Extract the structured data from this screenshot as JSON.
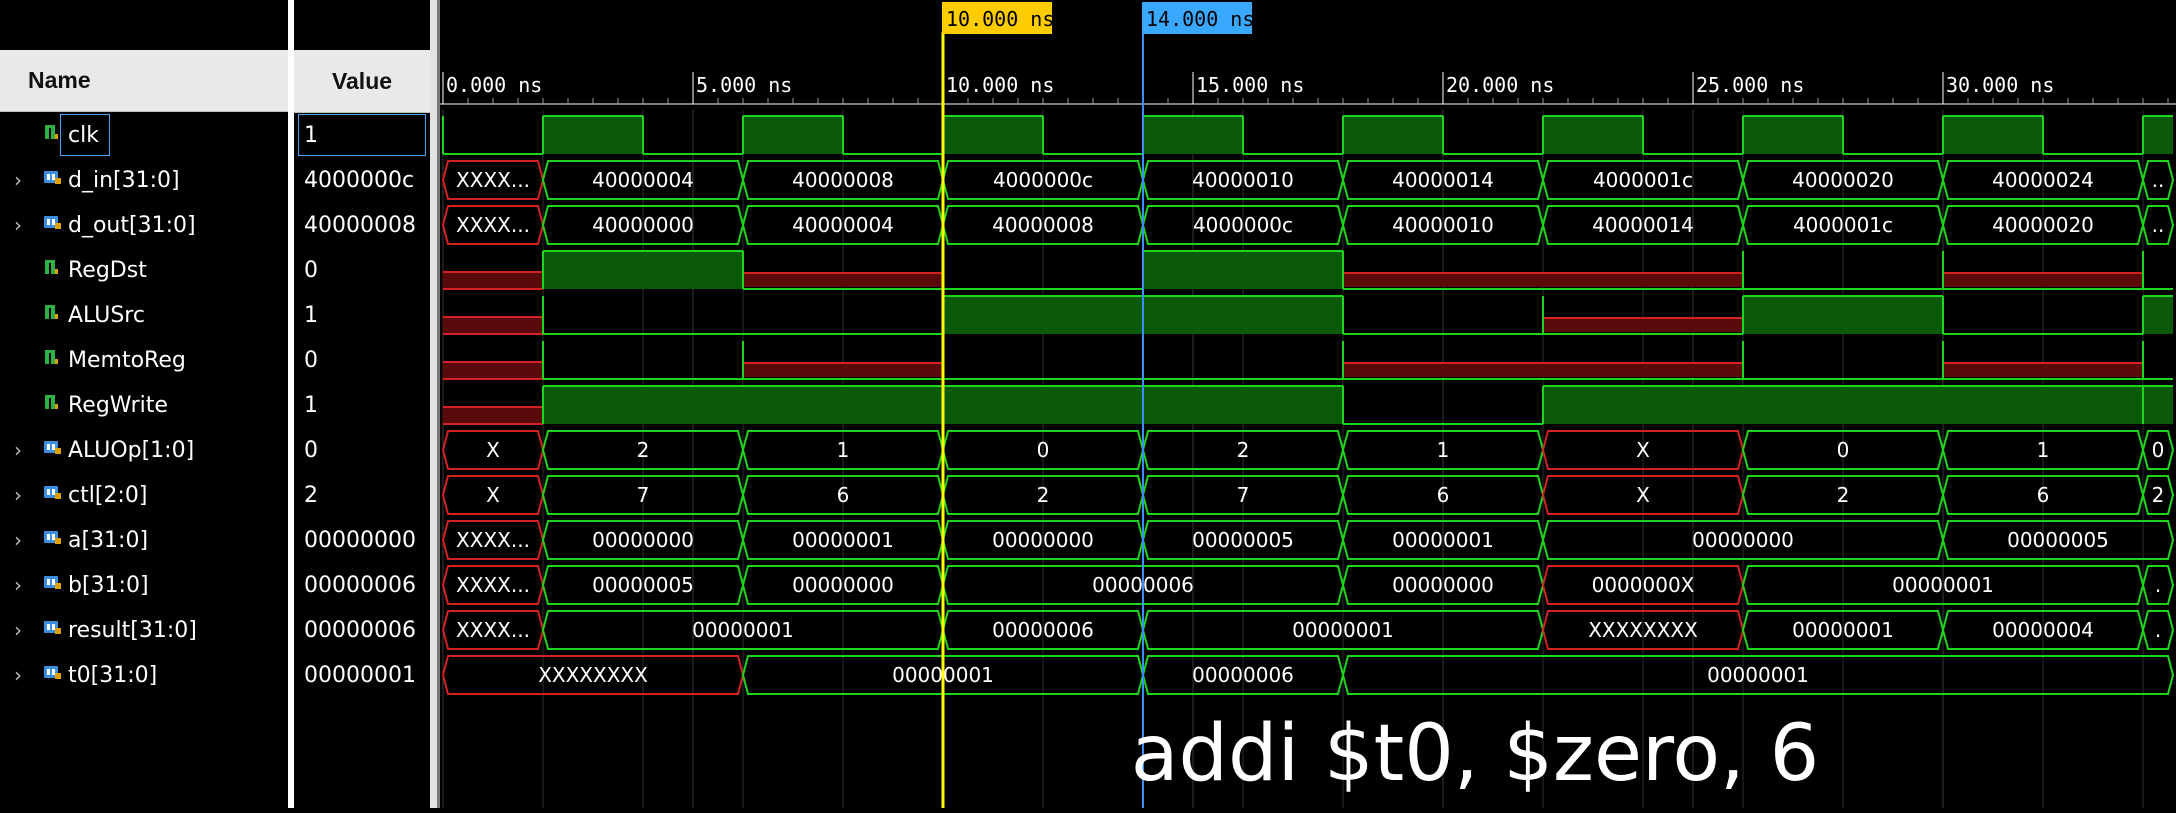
{
  "columns": {
    "name": "Name",
    "value": "Value"
  },
  "signals": [
    {
      "name": "clk",
      "value": "1",
      "icon": "bit-signal-icon",
      "expandable": false
    },
    {
      "name": "d_in[31:0]",
      "value": "4000000c",
      "icon": "bus-signal-icon",
      "expandable": true
    },
    {
      "name": "d_out[31:0]",
      "value": "40000008",
      "icon": "bus-signal-icon",
      "expandable": true
    },
    {
      "name": "RegDst",
      "value": "0",
      "icon": "bit-signal-icon",
      "expandable": false
    },
    {
      "name": "ALUSrc",
      "value": "1",
      "icon": "bit-signal-icon",
      "expandable": false
    },
    {
      "name": "MemtoReg",
      "value": "0",
      "icon": "bit-signal-icon",
      "expandable": false
    },
    {
      "name": "RegWrite",
      "value": "1",
      "icon": "bit-signal-icon",
      "expandable": false
    },
    {
      "name": "ALUOp[1:0]",
      "value": "0",
      "icon": "bus-signal-icon",
      "expandable": true
    },
    {
      "name": "ctl[2:0]",
      "value": "2",
      "icon": "bus-signal-icon",
      "expandable": true
    },
    {
      "name": "a[31:0]",
      "value": "00000000",
      "icon": "bus-signal-icon",
      "expandable": true
    },
    {
      "name": "b[31:0]",
      "value": "00000006",
      "icon": "bus-signal-icon",
      "expandable": true
    },
    {
      "name": "result[31:0]",
      "value": "00000006",
      "icon": "bus-signal-icon",
      "expandable": true
    },
    {
      "name": "t0[31:0]",
      "value": "00000001",
      "icon": "bus-signal-icon",
      "expandable": true
    }
  ],
  "timeline": {
    "ticks": [
      "0.000 ns",
      "5.000 ns",
      "10.000 ns",
      "15.000 ns",
      "20.000 ns",
      "25.000 ns",
      "30.000 ns"
    ],
    "ns_per_major": 5,
    "ns_per_minor": 0.5,
    "visible_ns": 34.6
  },
  "markers": [
    {
      "label": "10.000 ns",
      "time_ns": 10,
      "color": "#ffff00",
      "badge": "#ffcc00"
    },
    {
      "label": "14.000 ns",
      "time_ns": 14,
      "color": "#3a8fff",
      "badge": "#39a8ff"
    }
  ],
  "colors": {
    "high": "#1ed51e",
    "high_fill": "#0a5a0a",
    "unknown": "#d42222",
    "unknown_fill": "#5a0a0a",
    "bus": "#1ed51e",
    "text": "#ffffff"
  },
  "annotation": "addi $t0, $zero, 6",
  "waves": {
    "clk": {
      "type": "bit",
      "segs": [
        [
          0,
          2,
          "0"
        ],
        [
          2,
          4,
          "1"
        ],
        [
          4,
          6,
          "0"
        ],
        [
          6,
          8,
          "1"
        ],
        [
          8,
          10,
          "0"
        ],
        [
          10,
          12,
          "1"
        ],
        [
          12,
          14,
          "0"
        ],
        [
          14,
          16,
          "1"
        ],
        [
          16,
          18,
          "0"
        ],
        [
          18,
          20,
          "1"
        ],
        [
          20,
          22,
          "0"
        ],
        [
          22,
          24,
          "1"
        ],
        [
          24,
          26,
          "0"
        ],
        [
          26,
          28,
          "1"
        ],
        [
          28,
          30,
          "0"
        ],
        [
          30,
          32,
          "1"
        ],
        [
          32,
          34,
          "0"
        ],
        [
          34,
          34.6,
          "1"
        ]
      ]
    },
    "d_in": {
      "type": "bus",
      "segs": [
        [
          0,
          2,
          "XXXX...",
          "x"
        ],
        [
          2,
          6,
          "40000004"
        ],
        [
          6,
          10,
          "40000008"
        ],
        [
          10,
          14,
          "4000000c"
        ],
        [
          14,
          18,
          "40000010"
        ],
        [
          18,
          22,
          "40000014"
        ],
        [
          22,
          26,
          "4000001c"
        ],
        [
          26,
          30,
          "40000020"
        ],
        [
          30,
          34,
          "40000024"
        ],
        [
          34,
          34.6,
          ".."
        ]
      ]
    },
    "d_out": {
      "type": "bus",
      "segs": [
        [
          0,
          2,
          "XXXX...",
          "x"
        ],
        [
          2,
          6,
          "40000000"
        ],
        [
          6,
          10,
          "40000004"
        ],
        [
          10,
          14,
          "40000008"
        ],
        [
          14,
          18,
          "4000000c"
        ],
        [
          18,
          22,
          "40000010"
        ],
        [
          22,
          26,
          "40000014"
        ],
        [
          26,
          30,
          "4000001c"
        ],
        [
          30,
          34,
          "40000020"
        ],
        [
          34,
          34.6,
          ".."
        ]
      ]
    },
    "RegDst": {
      "type": "bit",
      "segs": [
        [
          0,
          2,
          "x"
        ],
        [
          2,
          6,
          "1"
        ],
        [
          6,
          10,
          "0x"
        ],
        [
          10,
          14,
          "0"
        ],
        [
          14,
          18,
          "1"
        ],
        [
          18,
          26,
          "0x"
        ],
        [
          26,
          30,
          "0"
        ],
        [
          30,
          34,
          "0x"
        ],
        [
          34,
          34.6,
          "0"
        ]
      ]
    },
    "ALUSrc": {
      "type": "bit",
      "segs": [
        [
          0,
          2,
          "x"
        ],
        [
          2,
          10,
          "0"
        ],
        [
          10,
          18,
          "1"
        ],
        [
          18,
          22,
          "0"
        ],
        [
          22,
          26,
          "0x"
        ],
        [
          26,
          30,
          "1"
        ],
        [
          30,
          34,
          "0"
        ],
        [
          34,
          34.6,
          "1"
        ]
      ]
    },
    "MemtoReg": {
      "type": "bit",
      "segs": [
        [
          0,
          2,
          "x"
        ],
        [
          2,
          6,
          "0"
        ],
        [
          6,
          10,
          "0x"
        ],
        [
          10,
          18,
          "0"
        ],
        [
          18,
          26,
          "0x"
        ],
        [
          26,
          30,
          "0"
        ],
        [
          30,
          34,
          "0x"
        ],
        [
          34,
          34.6,
          "0"
        ]
      ]
    },
    "RegWrite": {
      "type": "bit",
      "segs": [
        [
          0,
          2,
          "x"
        ],
        [
          2,
          18,
          "1"
        ],
        [
          18,
          22,
          "0"
        ],
        [
          22,
          34,
          "1"
        ],
        [
          34,
          34.6,
          "1"
        ]
      ]
    },
    "ALUOp": {
      "type": "bus",
      "segs": [
        [
          0,
          2,
          "X",
          "x"
        ],
        [
          2,
          6,
          "2"
        ],
        [
          6,
          10,
          "1"
        ],
        [
          10,
          14,
          "0"
        ],
        [
          14,
          18,
          "2"
        ],
        [
          18,
          22,
          "1"
        ],
        [
          22,
          26,
          "X",
          "x"
        ],
        [
          26,
          30,
          "0"
        ],
        [
          30,
          34,
          "1"
        ],
        [
          34,
          34.6,
          "0"
        ]
      ]
    },
    "ctl": {
      "type": "bus",
      "segs": [
        [
          0,
          2,
          "X",
          "x"
        ],
        [
          2,
          6,
          "7"
        ],
        [
          6,
          10,
          "6"
        ],
        [
          10,
          14,
          "2"
        ],
        [
          14,
          18,
          "7"
        ],
        [
          18,
          22,
          "6"
        ],
        [
          22,
          26,
          "X",
          "x"
        ],
        [
          26,
          30,
          "2"
        ],
        [
          30,
          34,
          "6"
        ],
        [
          34,
          34.6,
          "2"
        ]
      ]
    },
    "a": {
      "type": "bus",
      "segs": [
        [
          0,
          2,
          "XXXX...",
          "x"
        ],
        [
          2,
          6,
          "00000000"
        ],
        [
          6,
          10,
          "00000001"
        ],
        [
          10,
          14,
          "00000000"
        ],
        [
          14,
          18,
          "00000005"
        ],
        [
          18,
          22,
          "00000001"
        ],
        [
          22,
          30,
          "00000000"
        ],
        [
          30,
          34.6,
          "00000005"
        ]
      ]
    },
    "b": {
      "type": "bus",
      "segs": [
        [
          0,
          2,
          "XXXX...",
          "x"
        ],
        [
          2,
          6,
          "00000005"
        ],
        [
          6,
          10,
          "00000000"
        ],
        [
          10,
          18,
          "00000006"
        ],
        [
          18,
          22,
          "00000000"
        ],
        [
          22,
          26,
          "0000000X",
          "x"
        ],
        [
          26,
          34,
          "00000001"
        ],
        [
          34,
          34.6,
          "."
        ]
      ]
    },
    "result": {
      "type": "bus",
      "segs": [
        [
          0,
          2,
          "XXXX...",
          "x"
        ],
        [
          2,
          10,
          "00000001"
        ],
        [
          10,
          14,
          "00000006"
        ],
        [
          14,
          22,
          "00000001"
        ],
        [
          22,
          26,
          "XXXXXXXX",
          "x"
        ],
        [
          26,
          30,
          "00000001"
        ],
        [
          30,
          34,
          "00000004"
        ],
        [
          34,
          34.6,
          "."
        ]
      ]
    },
    "t0": {
      "type": "bus",
      "segs": [
        [
          0,
          6,
          "XXXXXXXX",
          "x"
        ],
        [
          6,
          14,
          "00000001"
        ],
        [
          14,
          18,
          "00000006"
        ],
        [
          18,
          34.6,
          "00000001"
        ]
      ]
    }
  }
}
